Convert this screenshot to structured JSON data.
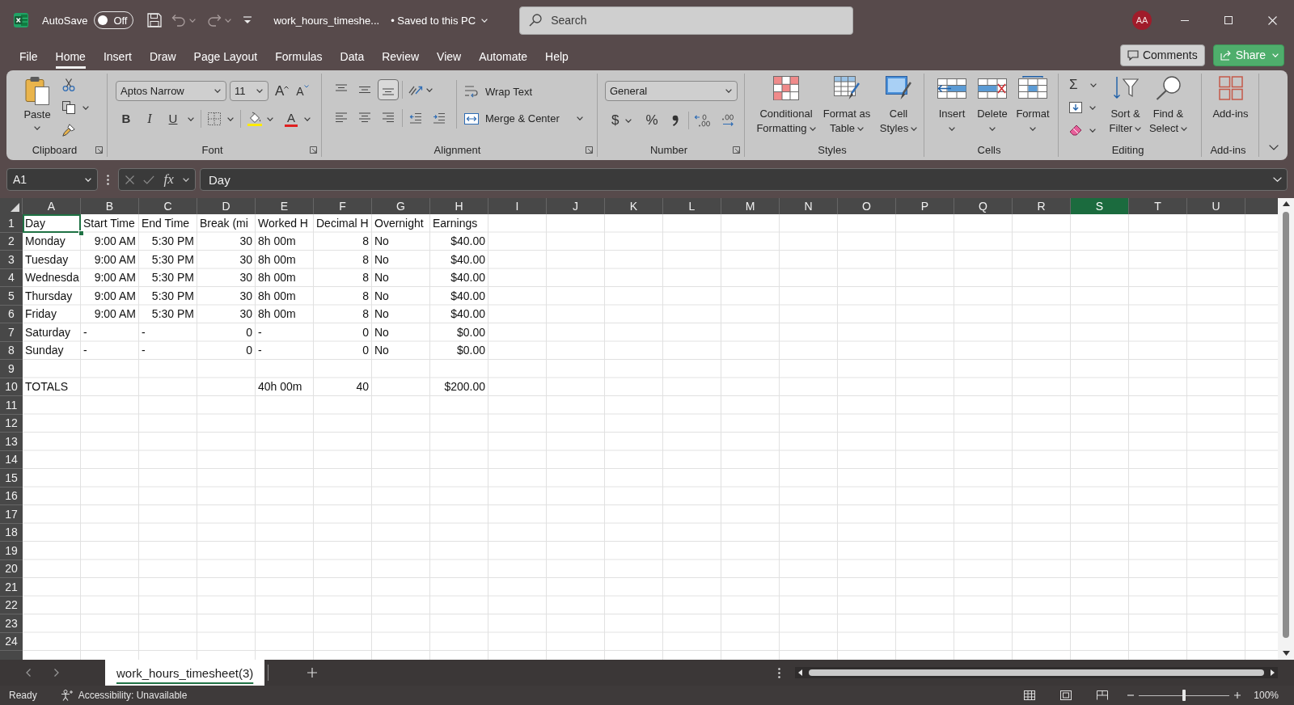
{
  "title_bar": {
    "autosave_label": "AutoSave",
    "autosave": {
      "on": false,
      "label": "Off"
    },
    "file_name": "work_hours_timeshe...",
    "save_status": "• Saved to this PC",
    "search": {
      "placeholder": "Search"
    },
    "avatar": "AA"
  },
  "ribbon_tabs": [
    {
      "label": "File",
      "selected": false
    },
    {
      "label": "Home",
      "selected": true
    },
    {
      "label": "Insert",
      "selected": false
    },
    {
      "label": "Draw",
      "selected": false
    },
    {
      "label": "Page Layout",
      "selected": false
    },
    {
      "label": "Formulas",
      "selected": false
    },
    {
      "label": "Data",
      "selected": false
    },
    {
      "label": "Review",
      "selected": false
    },
    {
      "label": "View",
      "selected": false
    },
    {
      "label": "Automate",
      "selected": false
    },
    {
      "label": "Help",
      "selected": false
    }
  ],
  "ribbon_actions": {
    "comments": "Comments",
    "share": "Share"
  },
  "ribbon": {
    "groups": [
      {
        "kind": "clipboard",
        "label": "Clipboard",
        "launcher": true,
        "paste": "Paste"
      },
      {
        "kind": "font",
        "label": "Font",
        "launcher": true,
        "font_name": "Aptos Narrow",
        "font_size": "11",
        "grow": "A",
        "shrink": "A",
        "bold": "B",
        "italic": "I",
        "underline": "U",
        "font_color": "A"
      },
      {
        "kind": "alignment",
        "label": "Alignment",
        "launcher": true,
        "align_buttons": [
          {
            "kind": "top",
            "selected": false
          },
          {
            "kind": "middle",
            "selected": false
          },
          {
            "kind": "bottom",
            "selected": true
          },
          {
            "kind": "left",
            "selected": false
          },
          {
            "kind": "center",
            "selected": false
          },
          {
            "kind": "right",
            "selected": false
          }
        ],
        "wrap_text": "Wrap Text",
        "merge": "Merge & Center"
      },
      {
        "kind": "number",
        "label": "Number",
        "launcher": true,
        "format": "General",
        "currency": "$",
        "percent": "%"
      },
      {
        "kind": "styles",
        "label": "Styles",
        "launcher": false,
        "buttons": [
          {
            "kind": "conditional",
            "label": "Conditional Formatting"
          },
          {
            "kind": "table",
            "label": "Format as Table"
          },
          {
            "kind": "cell-styles",
            "label": "Cell Styles"
          }
        ]
      },
      {
        "kind": "cells",
        "label": "Cells",
        "launcher": false,
        "buttons": [
          {
            "kind": "insert",
            "label": "Insert"
          },
          {
            "kind": "delete",
            "label": "Delete"
          },
          {
            "kind": "format",
            "label": "Format"
          }
        ]
      },
      {
        "kind": "editing",
        "label": "Editing",
        "launcher": false,
        "autosum": "Σ",
        "buttons": [
          {
            "kind": "sort",
            "label": "Sort & Filter"
          },
          {
            "kind": "find",
            "label": "Find & Select"
          }
        ]
      },
      {
        "kind": "addins",
        "label": "Add-ins",
        "launcher": false,
        "buttons": [
          {
            "kind": "addins",
            "label": "Add-ins"
          }
        ]
      }
    ]
  },
  "formula_bar": {
    "name_box": "A1",
    "function_label": "fx",
    "formula": "Day"
  },
  "sheet": {
    "columns": [
      {
        "label": "A",
        "highlighted": false
      },
      {
        "label": "B",
        "highlighted": false
      },
      {
        "label": "C",
        "highlighted": false
      },
      {
        "label": "D",
        "highlighted": false
      },
      {
        "label": "E",
        "highlighted": false
      },
      {
        "label": "F",
        "highlighted": false
      },
      {
        "label": "G",
        "highlighted": false
      },
      {
        "label": "H",
        "highlighted": false
      },
      {
        "label": "I",
        "highlighted": false
      },
      {
        "label": "J",
        "highlighted": false
      },
      {
        "label": "K",
        "highlighted": false
      },
      {
        "label": "L",
        "highlighted": false
      },
      {
        "label": "M",
        "highlighted": false
      },
      {
        "label": "N",
        "highlighted": false
      },
      {
        "label": "O",
        "highlighted": false
      },
      {
        "label": "P",
        "highlighted": false
      },
      {
        "label": "Q",
        "highlighted": false
      },
      {
        "label": "R",
        "highlighted": false
      },
      {
        "label": "S",
        "highlighted": true
      },
      {
        "label": "T",
        "highlighted": false
      },
      {
        "label": "U",
        "highlighted": false
      }
    ],
    "rows": [
      {
        "number": "1",
        "cells": [
          {
            "text": "Day",
            "kind": "text",
            "selected": true
          },
          {
            "text": "Start Time",
            "kind": "text",
            "selected": false
          },
          {
            "text": "End Time",
            "kind": "text",
            "selected": false
          },
          {
            "text": "Break (mi",
            "kind": "text",
            "selected": false
          },
          {
            "text": "Worked H",
            "kind": "text",
            "selected": false
          },
          {
            "text": "Decimal H",
            "kind": "text",
            "selected": false
          },
          {
            "text": "Overnight",
            "kind": "text",
            "selected": false
          },
          {
            "text": "Earnings",
            "kind": "text",
            "selected": false
          }
        ]
      },
      {
        "number": "2",
        "cells": [
          {
            "text": "Monday",
            "kind": "text",
            "selected": false
          },
          {
            "text": "9:00 AM",
            "kind": "number",
            "selected": false
          },
          {
            "text": "5:30 PM",
            "kind": "number",
            "selected": false
          },
          {
            "text": "30",
            "kind": "number",
            "selected": false
          },
          {
            "text": "8h 00m",
            "kind": "text",
            "selected": false
          },
          {
            "text": "8",
            "kind": "number",
            "selected": false
          },
          {
            "text": "No",
            "kind": "text",
            "selected": false
          },
          {
            "text": "$40.00",
            "kind": "number",
            "selected": false
          }
        ]
      },
      {
        "number": "3",
        "cells": [
          {
            "text": "Tuesday",
            "kind": "text",
            "selected": false
          },
          {
            "text": "9:00 AM",
            "kind": "number",
            "selected": false
          },
          {
            "text": "5:30 PM",
            "kind": "number",
            "selected": false
          },
          {
            "text": "30",
            "kind": "number",
            "selected": false
          },
          {
            "text": "8h 00m",
            "kind": "text",
            "selected": false
          },
          {
            "text": "8",
            "kind": "number",
            "selected": false
          },
          {
            "text": "No",
            "kind": "text",
            "selected": false
          },
          {
            "text": "$40.00",
            "kind": "number",
            "selected": false
          }
        ]
      },
      {
        "number": "4",
        "cells": [
          {
            "text": "Wednesda",
            "kind": "text",
            "selected": false
          },
          {
            "text": "9:00 AM",
            "kind": "number",
            "selected": false
          },
          {
            "text": "5:30 PM",
            "kind": "number",
            "selected": false
          },
          {
            "text": "30",
            "kind": "number",
            "selected": false
          },
          {
            "text": "8h 00m",
            "kind": "text",
            "selected": false
          },
          {
            "text": "8",
            "kind": "number",
            "selected": false
          },
          {
            "text": "No",
            "kind": "text",
            "selected": false
          },
          {
            "text": "$40.00",
            "kind": "number",
            "selected": false
          }
        ]
      },
      {
        "number": "5",
        "cells": [
          {
            "text": "Thursday",
            "kind": "text",
            "selected": false
          },
          {
            "text": "9:00 AM",
            "kind": "number",
            "selected": false
          },
          {
            "text": "5:30 PM",
            "kind": "number",
            "selected": false
          },
          {
            "text": "30",
            "kind": "number",
            "selected": false
          },
          {
            "text": "8h 00m",
            "kind": "text",
            "selected": false
          },
          {
            "text": "8",
            "kind": "number",
            "selected": false
          },
          {
            "text": "No",
            "kind": "text",
            "selected": false
          },
          {
            "text": "$40.00",
            "kind": "number",
            "selected": false
          }
        ]
      },
      {
        "number": "6",
        "cells": [
          {
            "text": "Friday",
            "kind": "text",
            "selected": false
          },
          {
            "text": "9:00 AM",
            "kind": "number",
            "selected": false
          },
          {
            "text": "5:30 PM",
            "kind": "number",
            "selected": false
          },
          {
            "text": "30",
            "kind": "number",
            "selected": false
          },
          {
            "text": "8h 00m",
            "kind": "text",
            "selected": false
          },
          {
            "text": "8",
            "kind": "number",
            "selected": false
          },
          {
            "text": "No",
            "kind": "text",
            "selected": false
          },
          {
            "text": "$40.00",
            "kind": "number",
            "selected": false
          }
        ]
      },
      {
        "number": "7",
        "cells": [
          {
            "text": "Saturday",
            "kind": "text",
            "selected": false
          },
          {
            "text": "-",
            "kind": "text",
            "selected": false
          },
          {
            "text": "-",
            "kind": "text",
            "selected": false
          },
          {
            "text": "0",
            "kind": "number",
            "selected": false
          },
          {
            "text": "-",
            "kind": "text",
            "selected": false
          },
          {
            "text": "0",
            "kind": "number",
            "selected": false
          },
          {
            "text": "No",
            "kind": "text",
            "selected": false
          },
          {
            "text": "$0.00",
            "kind": "number",
            "selected": false
          }
        ]
      },
      {
        "number": "8",
        "cells": [
          {
            "text": "Sunday",
            "kind": "text",
            "selected": false
          },
          {
            "text": "-",
            "kind": "text",
            "selected": false
          },
          {
            "text": "-",
            "kind": "text",
            "selected": false
          },
          {
            "text": "0",
            "kind": "number",
            "selected": false
          },
          {
            "text": "-",
            "kind": "text",
            "selected": false
          },
          {
            "text": "0",
            "kind": "number",
            "selected": false
          },
          {
            "text": "No",
            "kind": "text",
            "selected": false
          },
          {
            "text": "$0.00",
            "kind": "number",
            "selected": false
          }
        ]
      },
      {
        "number": "9"
      },
      {
        "number": "10",
        "cells": [
          {
            "text": "TOTALS",
            "kind": "text",
            "selected": false
          },
          null,
          null,
          null,
          {
            "text": "40h 00m",
            "kind": "text",
            "selected": false
          },
          {
            "text": "40",
            "kind": "number",
            "selected": false
          },
          null,
          {
            "text": "$200.00",
            "kind": "number",
            "selected": false
          }
        ]
      },
      {
        "number": "11"
      },
      {
        "number": "12"
      },
      {
        "number": "13"
      },
      {
        "number": "14"
      },
      {
        "number": "15"
      },
      {
        "number": "16"
      },
      {
        "number": "17"
      },
      {
        "number": "18"
      },
      {
        "number": "19"
      },
      {
        "number": "20"
      },
      {
        "number": "21"
      },
      {
        "number": "22"
      },
      {
        "number": "23"
      },
      {
        "number": "24"
      }
    ]
  },
  "sheet_tabs": [
    {
      "label": "work_hours_timesheet(3)",
      "selected": true
    }
  ],
  "status_bar": {
    "mode": "Ready",
    "accessibility": "Accessibility: Unavailable",
    "zoom": {
      "level": 0.5,
      "reading": "100%"
    }
  }
}
